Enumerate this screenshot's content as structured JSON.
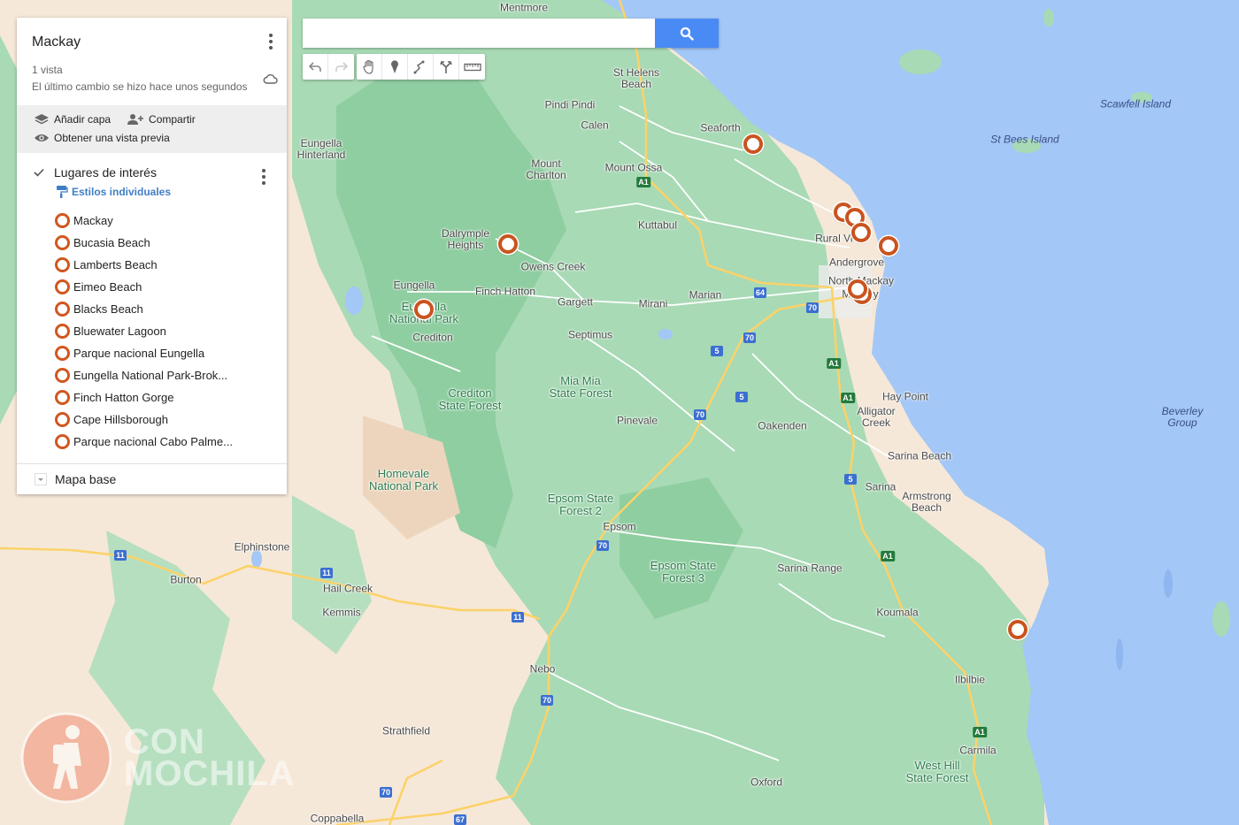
{
  "map_panel": {
    "title": "Mackay",
    "views": "1 vista",
    "last_change": "El último cambio se hizo hace unos segundos",
    "actions": {
      "add_layer": "Añadir capa",
      "share": "Compartir",
      "preview": "Obtener una vista previa"
    },
    "layer": {
      "title": "Lugares de interés",
      "checked": true,
      "styles_link": "Estilos individuales",
      "items": [
        {
          "label": "Mackay"
        },
        {
          "label": "Bucasia Beach"
        },
        {
          "label": "Lamberts Beach"
        },
        {
          "label": "Eimeo Beach"
        },
        {
          "label": "Blacks Beach"
        },
        {
          "label": "Bluewater Lagoon"
        },
        {
          "label": "Parque nacional Eungella"
        },
        {
          "label": "Eungella National Park-Brok..."
        },
        {
          "label": "Finch Hatton Gorge"
        },
        {
          "label": "Cape Hillsborough"
        },
        {
          "label": "Parque nacional Cabo Palme..."
        }
      ],
      "marker_color": "#d1571f"
    },
    "base_map": "Mapa base"
  },
  "search": {
    "value": "",
    "placeholder": "",
    "icon": "search-icon"
  },
  "toolbar": {
    "tools": [
      {
        "name": "undo-icon"
      },
      {
        "name": "redo-icon"
      },
      {
        "name": "hand-icon"
      },
      {
        "name": "marker-icon"
      },
      {
        "name": "draw-line-icon"
      },
      {
        "name": "directions-icon"
      },
      {
        "name": "ruler-icon"
      }
    ]
  },
  "map": {
    "colors": {
      "sea": "#a3c7f6",
      "land": "#f6e8d8",
      "forest": "#a8dab5",
      "road": "#ffffff",
      "highway": "#fbd26a",
      "marker": "#c9541f"
    },
    "places": [
      {
        "name": "Mentmore",
        "kind": "town"
      },
      {
        "name": "St Helens\nBeach",
        "kind": "town"
      },
      {
        "name": "Pindi Pindi",
        "kind": "town"
      },
      {
        "name": "Calen",
        "kind": "town"
      },
      {
        "name": "Seaforth",
        "kind": "town"
      },
      {
        "name": "Eungella\nHinterland",
        "kind": "town"
      },
      {
        "name": "Mount\nCharlton",
        "kind": "town"
      },
      {
        "name": "Mount Ossa",
        "kind": "town"
      },
      {
        "name": "Kuttabul",
        "kind": "town"
      },
      {
        "name": "Dalrymple\nHeights",
        "kind": "town"
      },
      {
        "name": "Owens Creek",
        "kind": "town"
      },
      {
        "name": "Rural View",
        "kind": "town"
      },
      {
        "name": "Andergrove",
        "kind": "town"
      },
      {
        "name": "North Mackay",
        "kind": "town"
      },
      {
        "name": "Mackay",
        "kind": "town"
      },
      {
        "name": "Eungella",
        "kind": "town"
      },
      {
        "name": "Finch Hatton",
        "kind": "town"
      },
      {
        "name": "Gargett",
        "kind": "town"
      },
      {
        "name": "Marian",
        "kind": "town"
      },
      {
        "name": "Mirani",
        "kind": "town"
      },
      {
        "name": "Eungella\nNational Park",
        "kind": "park"
      },
      {
        "name": "Crediton",
        "kind": "town"
      },
      {
        "name": "Septimus",
        "kind": "town"
      },
      {
        "name": "Crediton\nState Forest",
        "kind": "park"
      },
      {
        "name": "Mia Mia\nState Forest",
        "kind": "park"
      },
      {
        "name": "Pinevale",
        "kind": "town"
      },
      {
        "name": "Hay Point",
        "kind": "town"
      },
      {
        "name": "Alligator\nCreek",
        "kind": "town"
      },
      {
        "name": "Oakenden",
        "kind": "town"
      },
      {
        "name": "Sarina Beach",
        "kind": "town"
      },
      {
        "name": "Sarina",
        "kind": "town"
      },
      {
        "name": "Armstrong\nBeach",
        "kind": "town"
      },
      {
        "name": "Homevale\nNational Park",
        "kind": "park"
      },
      {
        "name": "Epsom State\nForest 2",
        "kind": "park"
      },
      {
        "name": "Epsom",
        "kind": "town"
      },
      {
        "name": "Elphinstone",
        "kind": "town"
      },
      {
        "name": "Burton",
        "kind": "town"
      },
      {
        "name": "Hail Creek",
        "kind": "town"
      },
      {
        "name": "Kemmis",
        "kind": "town"
      },
      {
        "name": "Epsom State\nForest 3",
        "kind": "park"
      },
      {
        "name": "Sarina Range",
        "kind": "town"
      },
      {
        "name": "Koumala",
        "kind": "town"
      },
      {
        "name": "Nebo",
        "kind": "town"
      },
      {
        "name": "Ilbilbie",
        "kind": "town"
      },
      {
        "name": "Strathfield",
        "kind": "town"
      },
      {
        "name": "Carmila",
        "kind": "town"
      },
      {
        "name": "West Hill\nState Forest",
        "kind": "park"
      },
      {
        "name": "Oxford",
        "kind": "town"
      },
      {
        "name": "Coppabella",
        "kind": "town"
      },
      {
        "name": "Scawfell Island",
        "kind": "island"
      },
      {
        "name": "St Bees Island",
        "kind": "island"
      },
      {
        "name": "Beverley\nGroup",
        "kind": "island"
      }
    ],
    "shields": [
      {
        "label": "A1",
        "type": "green"
      },
      {
        "label": "64",
        "type": "blue"
      },
      {
        "label": "70",
        "type": "blue"
      },
      {
        "label": "70",
        "type": "blue"
      },
      {
        "label": "5",
        "type": "blue"
      },
      {
        "label": "A1",
        "type": "green"
      },
      {
        "label": "5",
        "type": "blue"
      },
      {
        "label": "A1",
        "type": "green"
      },
      {
        "label": "70",
        "type": "blue"
      },
      {
        "label": "5",
        "type": "blue"
      },
      {
        "label": "A1",
        "type": "green"
      },
      {
        "label": "70",
        "type": "blue"
      },
      {
        "label": "11",
        "type": "blue"
      },
      {
        "label": "11",
        "type": "blue"
      },
      {
        "label": "11",
        "type": "blue"
      },
      {
        "label": "70",
        "type": "blue"
      },
      {
        "label": "A1",
        "type": "green"
      },
      {
        "label": "70",
        "type": "blue"
      },
      {
        "label": "67",
        "type": "blue"
      }
    ],
    "marker_count": 11
  },
  "watermark": {
    "text": "CON\nMOCHILA",
    "icon": "hiker-logo-icon"
  }
}
